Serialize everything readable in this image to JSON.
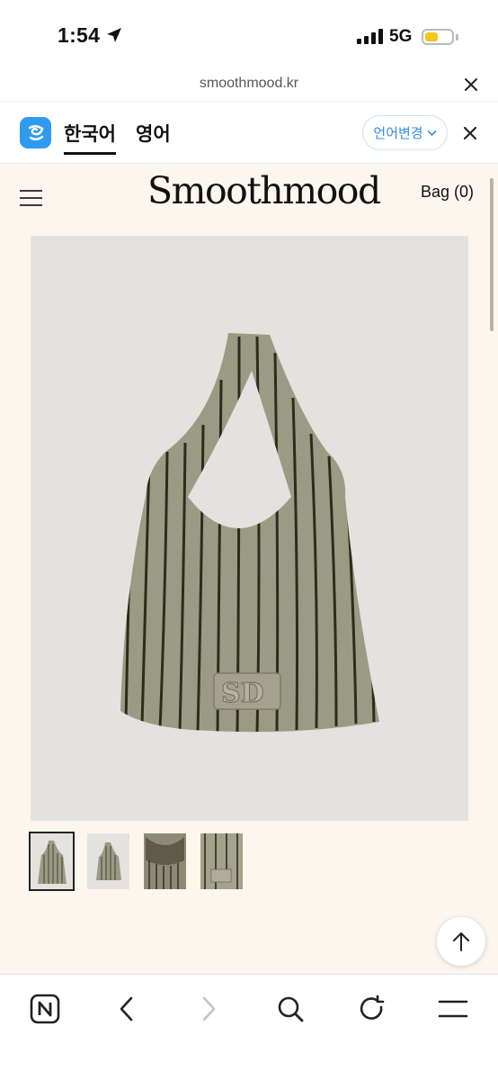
{
  "status_bar": {
    "time": "1:54",
    "network": "5G",
    "battery_color": "#f2c81a"
  },
  "url_bar": {
    "domain": "smoothmood.kr"
  },
  "translate_bar": {
    "tabs": [
      "한국어",
      "영어"
    ],
    "active_tab": "한국어",
    "change_button": "언어변경",
    "accent": "#2f9bf0"
  },
  "header": {
    "logo": "Smoothmood",
    "bag": "Bag (0)"
  },
  "product": {
    "thumbnail_count": 4,
    "selected_thumbnail": 1,
    "background": "#fcf6ef",
    "image_background": "#e4e2df",
    "bag_color": "#9b9a83",
    "stripe_color": "#2f2b1c"
  },
  "browser_toolbar": {
    "icons": [
      "naver-home-icon",
      "back-icon",
      "forward-icon",
      "search-icon",
      "reload-icon",
      "menu-icon"
    ]
  }
}
